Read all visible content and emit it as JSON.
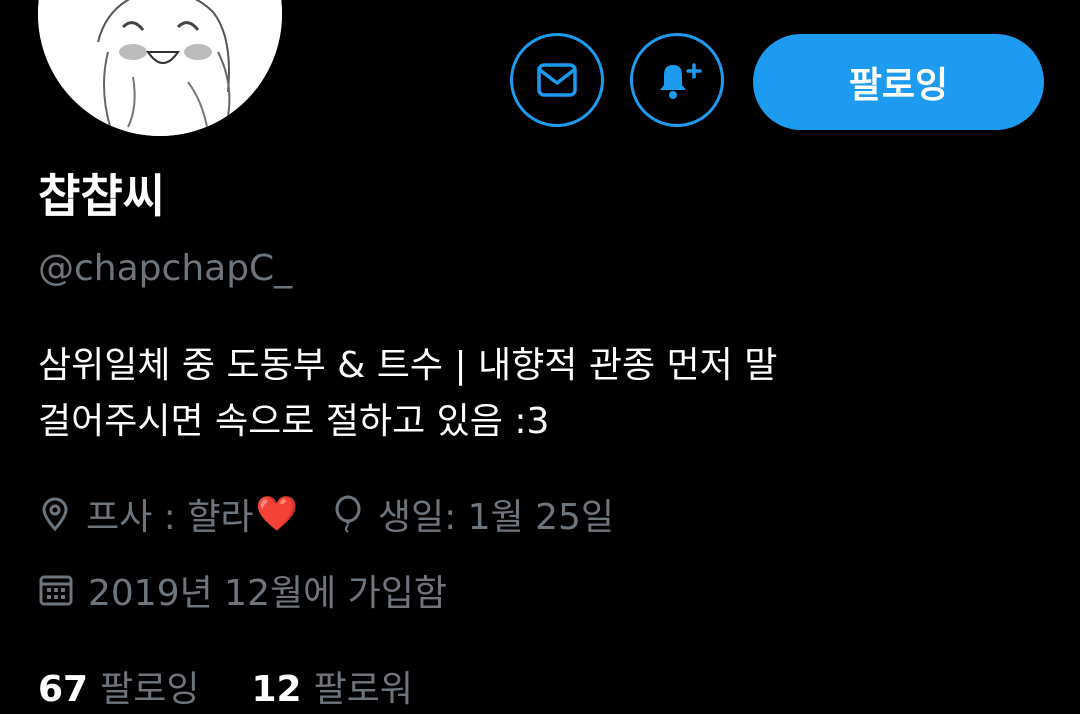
{
  "profile": {
    "display_name": "챱챱씨",
    "handle": "@chapchapC_",
    "bio_lines": [
      "삼위일체 중 도동부 & 트수 |  내향적 관종 먼저 말",
      "걸어주시면 속으로 절하고 있음 :3"
    ],
    "location": "프사 : 햘라",
    "location_emoji": "❤️",
    "birthday": "생일: 1월 25일",
    "joined": "2019년 12월에 가입함"
  },
  "actions": {
    "message_icon": "envelope-icon",
    "notify_icon": "bell-plus-icon",
    "follow_label": "팔로잉"
  },
  "stats": {
    "following_count": "67",
    "following_label": "팔로잉",
    "followers_count": "12",
    "followers_label": "팔로워"
  },
  "colors": {
    "accent": "#1d9bf0",
    "background": "#000000",
    "muted": "#6e767d",
    "text": "#ffffff"
  }
}
